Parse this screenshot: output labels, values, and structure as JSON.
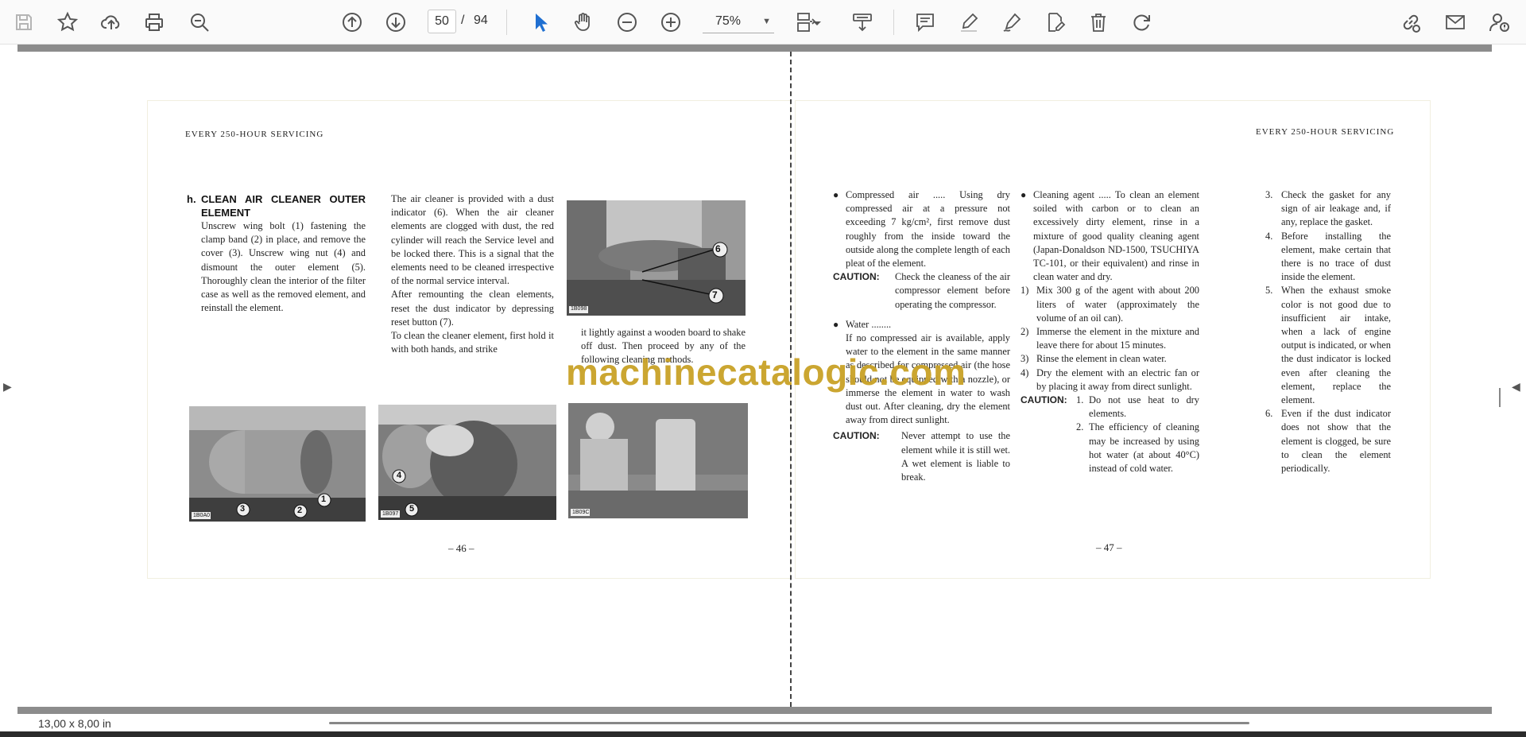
{
  "toolbar": {
    "page_current": "50",
    "page_separator": "/",
    "page_total": "94",
    "zoom": "75%"
  },
  "status": {
    "page_size": "13,00 x 8,00 in"
  },
  "watermark": "machinecatalogic.com",
  "left_page": {
    "header": "EVERY 250-HOUR SERVICING",
    "section_label": "h.",
    "section_title": "CLEAN AIR CLEANER OUTER ELEMENT",
    "col1_text": "Unscrew wing bolt (1) fastening the clamp band (2) in place, and remove the cover (3). Unscrew wing nut (4) and dismount the outer element (5). Thoroughly clean the interior of the filter case as well as the removed element, and reinstall the element.",
    "col2_p1": "The air cleaner is provided with a dust indicator (6). When the air cleaner elements are clogged with dust, the red cylinder will reach the Service level and be locked there. This is a signal that the elements need to be cleaned irrespective of the normal service interval.",
    "col2_p2": "After remounting the clean elements, reset the dust indicator by depressing reset button (7).",
    "col2_p3": "To clean the cleaner element, first hold it with both hands, and strike",
    "col3_text": "it lightly against a wooden board to shake off dust. Then proceed by any of the following cleaning methods.",
    "photo_top_labels": [
      "6",
      "7"
    ],
    "photo_top_code": "1B098",
    "photo_b1_labels": [
      "3",
      "2",
      "1"
    ],
    "photo_b1_code": "1B0A0",
    "photo_b2_labels": [
      "4",
      "5"
    ],
    "photo_b2_code": "1B097",
    "photo_b3_code": "1B09C",
    "page_number": "– 46 –"
  },
  "right_page": {
    "header": "EVERY 250-HOUR SERVICING",
    "colA": {
      "bullet1": "Compressed air ..... Using dry compressed air at a pressure not exceeding 7 kg/cm², first remove dust roughly from the inside toward the outside along the complete length of each pleat of the element.",
      "caution1_label": "CAUTION:",
      "caution1_text": "Check the cleaness of the air compressor element before operating the compressor.",
      "bullet2_title": "Water ........",
      "bullet2_text": "If no compressed air is available, apply water to the element in the same manner as described for compressed air (the hose should not be equipped with a nozzle), or immerse the element in water to wash dust out. After cleaning, dry the element away from direct sunlight.",
      "caution2_label": "CAUTION:",
      "caution2_text": "Never attempt to use the element while it is still wet. A wet element is liable to break."
    },
    "colB": {
      "bullet1": "Cleaning agent ..... To clean an element soiled with carbon or to clean an excessively dirty element, rinse in a mixture of good quality cleaning agent (Japan-Donaldson ND-1500, TSUCHIYA TC-101, or their equivalent) and rinse in clean water and dry.",
      "steps": [
        {
          "num": "1)",
          "text": "Mix 300 g of the agent with about 200 liters of water (approximately the volume of an oil can)."
        },
        {
          "num": "2)",
          "text": "Immerse the element in the mixture and leave there for about 15 minutes."
        },
        {
          "num": "3)",
          "text": "Rinse the element in clean water."
        },
        {
          "num": "4)",
          "text": "Dry the element with an electric fan or by placing it away from direct sunlight."
        }
      ],
      "caution_label": "CAUTION:",
      "caution_items": [
        {
          "num": "1.",
          "text": "Do not use heat to dry elements."
        },
        {
          "num": "2.",
          "text": "The efficiency of cleaning may be increased by using hot water (at about 40°C) instead of cold water."
        }
      ]
    },
    "colC": {
      "items": [
        {
          "num": "3.",
          "text": "Check the gasket for any sign of air leakage and, if any, replace the gasket."
        },
        {
          "num": "4.",
          "text": "Before installing the element, make certain that there is no trace of dust inside the element."
        },
        {
          "num": "5.",
          "text": "When the exhaust smoke color is not good due to insufficient air intake, when a lack of engine output is indicated, or when the dust indicator is locked even after cleaning the element, replace the element."
        },
        {
          "num": "6.",
          "text": "Even if the dust indicator does not show that the element is clogged, be sure to clean the element periodically."
        }
      ]
    },
    "page_number": "– 47 –"
  }
}
